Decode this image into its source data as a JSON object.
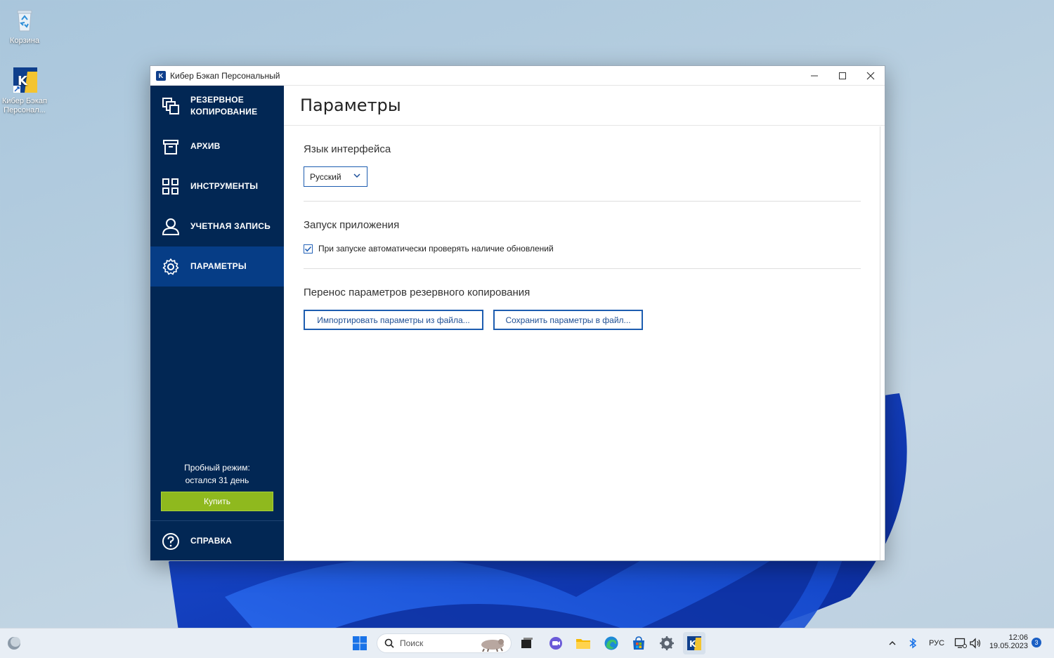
{
  "desktop": {
    "icons": [
      {
        "label": "Корзина"
      },
      {
        "label": "Кибер Бэкап Персонал..."
      }
    ]
  },
  "window": {
    "title": "Кибер Бэкап Персональный",
    "controls": {
      "minimize": "—",
      "maximize": "☐",
      "close": "✕"
    }
  },
  "sidebar": {
    "items": [
      {
        "label": "РЕЗЕРВНОЕ\nКОПИРОВАНИЕ",
        "icon": "backup-icon",
        "active": false
      },
      {
        "label": "АРХИВ",
        "icon": "archive-icon",
        "active": false
      },
      {
        "label": "ИНСТРУМЕНТЫ",
        "icon": "tools-icon",
        "active": false
      },
      {
        "label": "УЧЕТНАЯ ЗАПИСЬ",
        "icon": "account-icon",
        "active": false
      },
      {
        "label": "ПАРАМЕТРЫ",
        "icon": "gear-icon",
        "active": true
      }
    ],
    "trial_line1": "Пробный режим:",
    "trial_line2": "остался 31 день",
    "buy_label": "Купить",
    "help_label": "СПРАВКА",
    "colors": {
      "background": "#022754",
      "active": "#063d86",
      "buy": "#8fb91e"
    }
  },
  "main": {
    "page_title": "Параметры",
    "language": {
      "heading": "Язык интерфейса",
      "selected": "Русский"
    },
    "startup": {
      "heading": "Запуск приложения",
      "auto_update_check_label": "При запуске автоматически проверять наличие обновлений",
      "auto_update_check_checked": true
    },
    "transfer": {
      "heading": "Перенос параметров резервного копирования",
      "import_label": "Импортировать параметры из файла...",
      "save_label": "Сохранить параметры в файл..."
    }
  },
  "taskbar": {
    "search_placeholder": "Поиск",
    "language": "РУС",
    "time": "12:06",
    "date": "19.05.2023",
    "notification_count": "3"
  }
}
